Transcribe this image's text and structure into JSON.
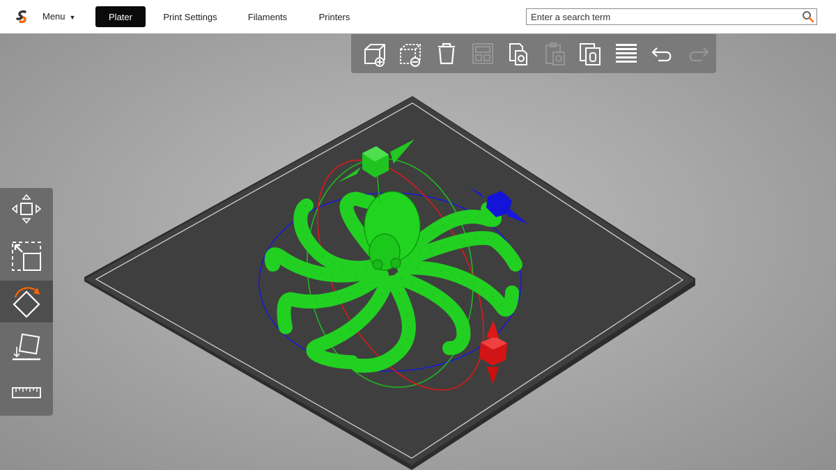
{
  "header": {
    "menu_label": "Menu",
    "tabs": [
      {
        "label": "Plater",
        "active": true
      },
      {
        "label": "Print Settings",
        "active": false
      },
      {
        "label": "Filaments",
        "active": false
      },
      {
        "label": "Printers",
        "active": false
      }
    ],
    "search_placeholder": "Enter a search term",
    "brand_color": "#ff6600"
  },
  "top_toolbar": {
    "buttons": [
      {
        "icon": "add-object-icon",
        "enabled": true
      },
      {
        "icon": "remove-object-icon",
        "enabled": true
      },
      {
        "icon": "delete-all-icon",
        "enabled": true
      },
      {
        "icon": "arrange-icon",
        "enabled": false
      },
      {
        "icon": "copy-icon",
        "enabled": true
      },
      {
        "icon": "paste-icon",
        "enabled": false
      },
      {
        "icon": "add-instance-icon",
        "enabled": true
      },
      {
        "icon": "split-to-objects-icon",
        "enabled": true
      },
      {
        "icon": "undo-icon",
        "enabled": true
      },
      {
        "icon": "redo-icon",
        "enabled": false
      }
    ]
  },
  "left_toolbar": {
    "tools": [
      {
        "icon": "move-icon",
        "active": false
      },
      {
        "icon": "scale-icon",
        "active": false
      },
      {
        "icon": "rotate-icon",
        "active": true
      },
      {
        "icon": "place-on-face-icon",
        "active": false
      },
      {
        "icon": "measure-icon",
        "active": false
      }
    ]
  },
  "scene": {
    "model_color": "#1fd21f",
    "bed_color": "#3d3d3d",
    "gizmo_colors": {
      "x": "#e01010",
      "y": "#10b010",
      "z": "#1010d0"
    }
  }
}
